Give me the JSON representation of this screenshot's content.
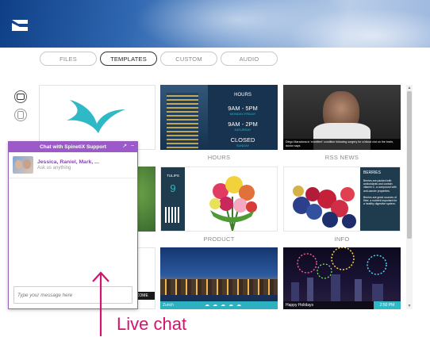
{
  "tabs": [
    {
      "label": "FILES",
      "active": false
    },
    {
      "label": "TEMPLATES",
      "active": true
    },
    {
      "label": "CUSTOM",
      "active": false
    },
    {
      "label": "AUDIO",
      "active": false
    }
  ],
  "tiles": {
    "hours": {
      "heading": "HOURS",
      "rows": [
        {
          "time": "9AM - 5PM",
          "days": "MONDAY-FRIDAY"
        },
        {
          "time": "9AM - 2PM",
          "days": "SATURDAY"
        },
        {
          "time": "CLOSED",
          "days": "SUNDAY"
        }
      ],
      "label": "HOURS"
    },
    "rss": {
      "caption": "Diego Maradona in 'excellent' condition following surgery for a blood clot on the brain, doctor says",
      "label": "RSS NEWS"
    },
    "product": {
      "name": "TULIPS",
      "price": "9",
      "label": "PRODUCT"
    },
    "info": {
      "heading": "BERRIES",
      "para1": "Berries are packed with antioxidants and contain vitamin C, a compound with anti-cancer properties.",
      "para2": "Berries are great sources of fiber, a nutrient important for a healthy digestive system.",
      "label": "INFO"
    },
    "zurich": {
      "caption": "Zurich"
    },
    "holiday": {
      "caption": "Happy Holidays",
      "time": "2:50 PM"
    },
    "welcome": {
      "caption": "LCOME"
    }
  },
  "chat": {
    "title": "Chat with SpinetiX Support",
    "controls": [
      "↗",
      "–"
    ],
    "agents": "Jessica, Raniel, Mark, ...",
    "subtitle": "Ask us anything",
    "placeholder": "Type your message here"
  },
  "annotation": {
    "text": "Live chat"
  },
  "colors": {
    "accent": "#9b59c9",
    "annotation": "#d2146e",
    "teal": "#2fb8c6"
  }
}
